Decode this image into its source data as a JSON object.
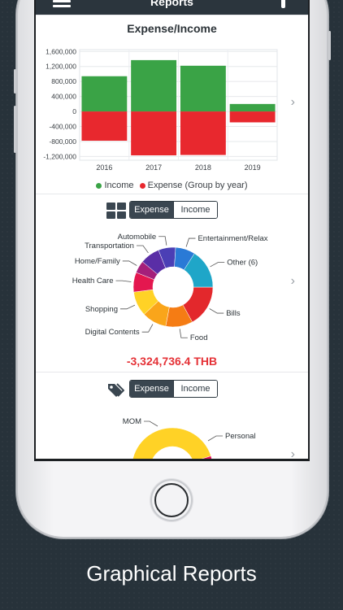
{
  "app": {
    "nav_title": "Reports",
    "caption": "Graphical Reports"
  },
  "colors": {
    "income": "#3aa346",
    "expense": "#e8282e",
    "accent_dark": "#3a4650",
    "negative_total": "#e53237"
  },
  "icons": [
    "menu-icon",
    "filter-icon",
    "grid-icon",
    "tag-icon",
    "chevron-right-icon"
  ],
  "bar_card": {
    "title": "Expense/Income",
    "legend_income": "Income",
    "legend_expense": "Expense",
    "legend_group": "(Group by year)"
  },
  "category_card": {
    "toggle_expense": "Expense",
    "toggle_income": "Income",
    "selected": "Expense",
    "total": "-3,324,736.4 THB"
  },
  "tag_card": {
    "toggle_expense": "Expense",
    "toggle_income": "Income",
    "selected": "Expense"
  },
  "chart_data": [
    {
      "type": "bar",
      "title": "Expense/Income",
      "categories": [
        "2016",
        "2017",
        "2018",
        "2019"
      ],
      "series": [
        {
          "name": "Income",
          "values": [
            940000,
            1370000,
            1220000,
            200000
          ]
        },
        {
          "name": "Expense",
          "values": [
            -780000,
            -1170000,
            -1160000,
            -290000
          ]
        }
      ],
      "yticks": [
        "1,600,000",
        "1,200,000",
        "800,000",
        "400,000",
        "0",
        "-400,000",
        "-800,000",
        "-1,200,000"
      ],
      "ylim": [
        -1300000,
        1650000
      ],
      "grid": true,
      "legend": "bottom"
    },
    {
      "type": "pie",
      "donut": true,
      "labels": [
        "Bills",
        "Food",
        "Digital Contents",
        "Shopping",
        "Health Care",
        "Home/Family",
        "Transportation",
        "Automobile",
        "Entertainment/Relax",
        "Other (6)"
      ],
      "values": [
        17,
        11,
        10,
        10,
        8,
        5,
        8,
        7,
        8,
        16
      ],
      "colors": [
        "#e3282c",
        "#f57c14",
        "#faa51a",
        "#ffd226",
        "#e4174f",
        "#a51f7a",
        "#5a2ea6",
        "#4b3fb5",
        "#2a7ad6",
        "#1fa6c8"
      ]
    },
    {
      "type": "pie",
      "donut": true,
      "labels": [
        "MOM",
        "Personal"
      ],
      "values": [
        45,
        55
      ],
      "colors": [
        "#ffd226",
        "#e0145a"
      ]
    }
  ]
}
